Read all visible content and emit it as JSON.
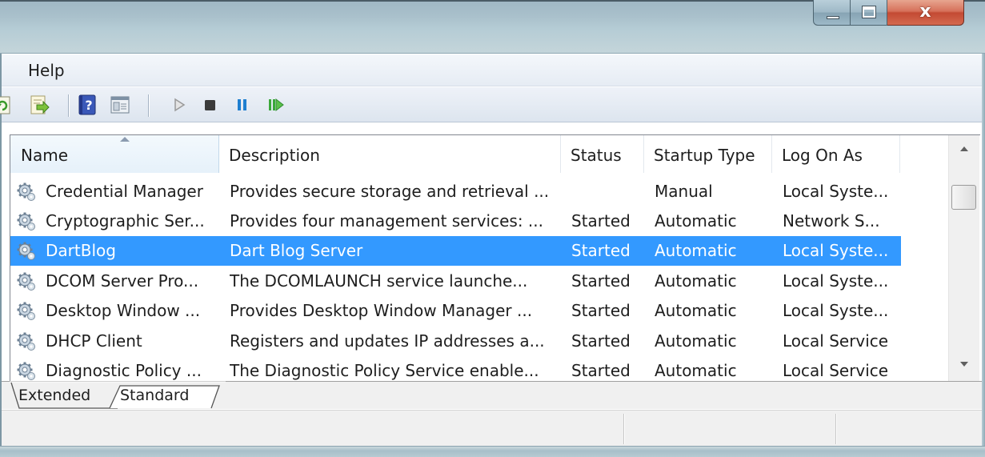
{
  "window": {
    "controls": {
      "close_label": "x"
    }
  },
  "menu": {
    "items": [
      "Help"
    ]
  },
  "toolbar": {
    "icons": [
      "refresh-icon",
      "export-list-icon",
      "help-icon",
      "properties-icon",
      "start-service-icon",
      "stop-service-icon",
      "pause-service-icon",
      "restart-service-icon"
    ]
  },
  "table": {
    "columns": [
      "Name",
      "Description",
      "Status",
      "Startup Type",
      "Log On As"
    ],
    "sorted_column": "Name",
    "rows": [
      {
        "name": "Credential Manager",
        "description": "Provides secure storage and retrieval ...",
        "status": "",
        "startup": "Manual",
        "logon": "Local Syste..."
      },
      {
        "name": "Cryptographic Ser...",
        "description": "Provides four management services: ...",
        "status": "Started",
        "startup": "Automatic",
        "logon": "Network S..."
      },
      {
        "name": "DartBlog",
        "description": "Dart Blog Server",
        "status": "Started",
        "startup": "Automatic",
        "logon": "Local Syste..."
      },
      {
        "name": "DCOM Server Pro...",
        "description": "The DCOMLAUNCH service launche...",
        "status": "Started",
        "startup": "Automatic",
        "logon": "Local Syste..."
      },
      {
        "name": "Desktop Window ...",
        "description": "Provides Desktop Window Manager ...",
        "status": "Started",
        "startup": "Automatic",
        "logon": "Local Syste..."
      },
      {
        "name": "DHCP Client",
        "description": "Registers and updates IP addresses a...",
        "status": "Started",
        "startup": "Automatic",
        "logon": "Local Service"
      },
      {
        "name": "Diagnostic Policy ...",
        "description": "The Diagnostic Policy Service enable...",
        "status": "Started",
        "startup": "Automatic",
        "logon": "Local Service"
      }
    ],
    "selected_row": "DartBlog"
  },
  "tabs": {
    "items": [
      "Extended",
      "Standard"
    ],
    "active": "Standard"
  },
  "colors": {
    "selection": "#3399ff",
    "selection_text": "#ffffff"
  }
}
